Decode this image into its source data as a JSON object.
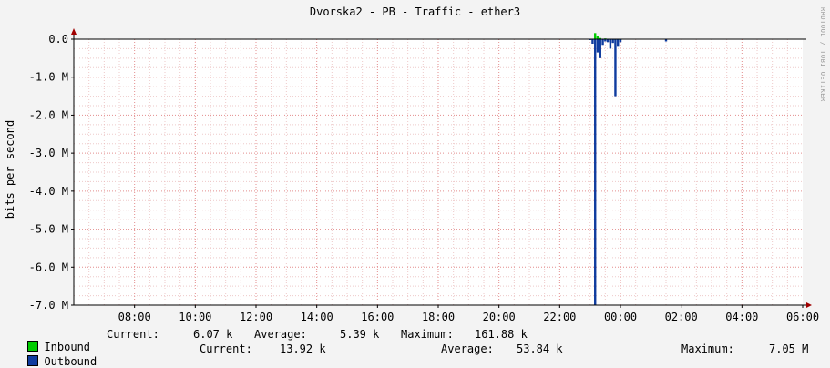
{
  "title": "Dvorska2 - PB - Traffic - ether3",
  "ylabel": "bits per second",
  "watermark": "RRDTOOL / TOBI OETIKER",
  "colors": {
    "background": "#f3f3f3",
    "plot": "#ffffff",
    "grid": "#e8b4b4",
    "axis": "#000000",
    "inbound": "#00cc00",
    "outbound": "#0f3c9f"
  },
  "chart_data": {
    "type": "area",
    "title": "Dvorska2 - PB - Traffic - ether3",
    "ylabel": "bits per second",
    "xlabel": "",
    "ylim": [
      -7.0,
      0.0
    ],
    "y_unit": "M",
    "yticks": [
      0.0,
      -1.0,
      -2.0,
      -3.0,
      -4.0,
      -5.0,
      -6.0,
      -7.0
    ],
    "ytick_labels": [
      "0.0",
      "-1.0 M",
      "-2.0 M",
      "-3.0 M",
      "-4.0 M",
      "-5.0 M",
      "-6.0 M",
      "-7.0 M"
    ],
    "xlim": [
      "06:00",
      "06:00 (next day)"
    ],
    "xticks": [
      "08:00",
      "10:00",
      "12:00",
      "14:00",
      "16:00",
      "18:00",
      "20:00",
      "22:00",
      "00:00",
      "02:00",
      "04:00",
      "06:00"
    ],
    "grid": true,
    "series": [
      {
        "name": "Inbound",
        "color": "#00cc00",
        "x": [
          "23:05",
          "23:10",
          "23:15",
          "23:20",
          "23:25",
          "23:30",
          "23:35",
          "23:40",
          "23:45",
          "23:50",
          "23:55",
          "00:00"
        ],
        "values": [
          0.0,
          0.16,
          0.09,
          0.03,
          0.01,
          0.02,
          0.01,
          0.0,
          0.01,
          0.0,
          0.0,
          0.0
        ]
      },
      {
        "name": "Outbound",
        "color": "#0f3c9f",
        "x": [
          "23:00",
          "23:05",
          "23:10",
          "23:15",
          "23:20",
          "23:25",
          "23:30",
          "23:35",
          "23:40",
          "23:45",
          "23:50",
          "23:55",
          "00:00",
          "01:30"
        ],
        "values": [
          0.0,
          -0.12,
          -7.0,
          -0.35,
          -0.5,
          -0.15,
          -0.06,
          -0.08,
          -0.25,
          -0.1,
          -1.5,
          -0.2,
          -0.08,
          -0.06
        ]
      }
    ]
  },
  "legend": {
    "inbound": {
      "label": "Inbound",
      "current_label": "Current:",
      "current": "6.07 k",
      "average_label": "Average:",
      "average": "5.39 k",
      "maximum_label": "Maximum:",
      "maximum": "161.88 k"
    },
    "outbound": {
      "label": "Outbound",
      "current_label": "Current:",
      "current": "13.92 k",
      "average_label": "Average:",
      "average": "53.84 k",
      "maximum_label": "Maximum:",
      "maximum": "7.05 M"
    }
  }
}
